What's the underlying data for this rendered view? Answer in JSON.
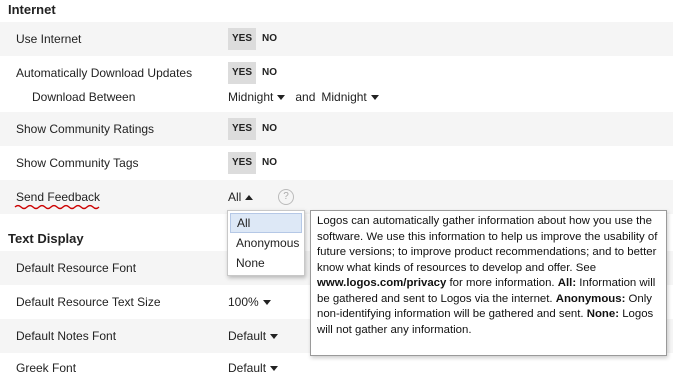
{
  "internet_section": {
    "title": "Internet",
    "rows": {
      "use_internet": {
        "label": "Use Internet",
        "yes": "YES",
        "no": "NO"
      },
      "auto_download": {
        "label": "Automatically Download Updates",
        "yes": "YES",
        "no": "NO"
      },
      "download_between": {
        "label": "Download Between",
        "start": "Midnight",
        "and": "and",
        "end": "Midnight"
      },
      "community_ratings": {
        "label": "Show Community Ratings",
        "yes": "YES",
        "no": "NO"
      },
      "community_tags": {
        "label": "Show Community Tags",
        "yes": "YES",
        "no": "NO"
      },
      "send_feedback": {
        "label": "Send Feedback",
        "value": "All",
        "help_icon": "question-mark-icon"
      }
    }
  },
  "feedback_dropdown": {
    "options": [
      "All",
      "Anonymous",
      "None"
    ],
    "selected": "All"
  },
  "feedback_tooltip": {
    "intro": "Logos can automatically gather information about how you use the software. We use this information to help us improve the usability of future versions; to improve product recommendations; and to better know what kinds of resources to develop and offer. See ",
    "link": "www.logos.com/privacy",
    "after_link": " for more information. ",
    "all_label": "All:",
    "all_text": " Information will be gathered and sent to Logos via the internet. ",
    "anon_label": "Anonymous:",
    "anon_text": " Only non-identifying information will be gathered and sent. ",
    "none_label": "None:",
    "none_text": " Logos will not gather any information."
  },
  "text_display_section": {
    "title": "Text Display",
    "rows": {
      "resource_font": {
        "label": "Default Resource Font"
      },
      "resource_text_size": {
        "label": "Default Resource Text Size",
        "value": "100%"
      },
      "notes_font": {
        "label": "Default Notes Font",
        "value": "Default"
      },
      "partial": {
        "label": "Greek Font",
        "value": "Default"
      }
    }
  },
  "colors": {
    "yes_selected_bg": "#dcdcdc",
    "alt_row_bg": "#f5f5f5",
    "squiggle_underline": "#cc0000",
    "dropdown_selected_bg": "#dde8f6"
  }
}
